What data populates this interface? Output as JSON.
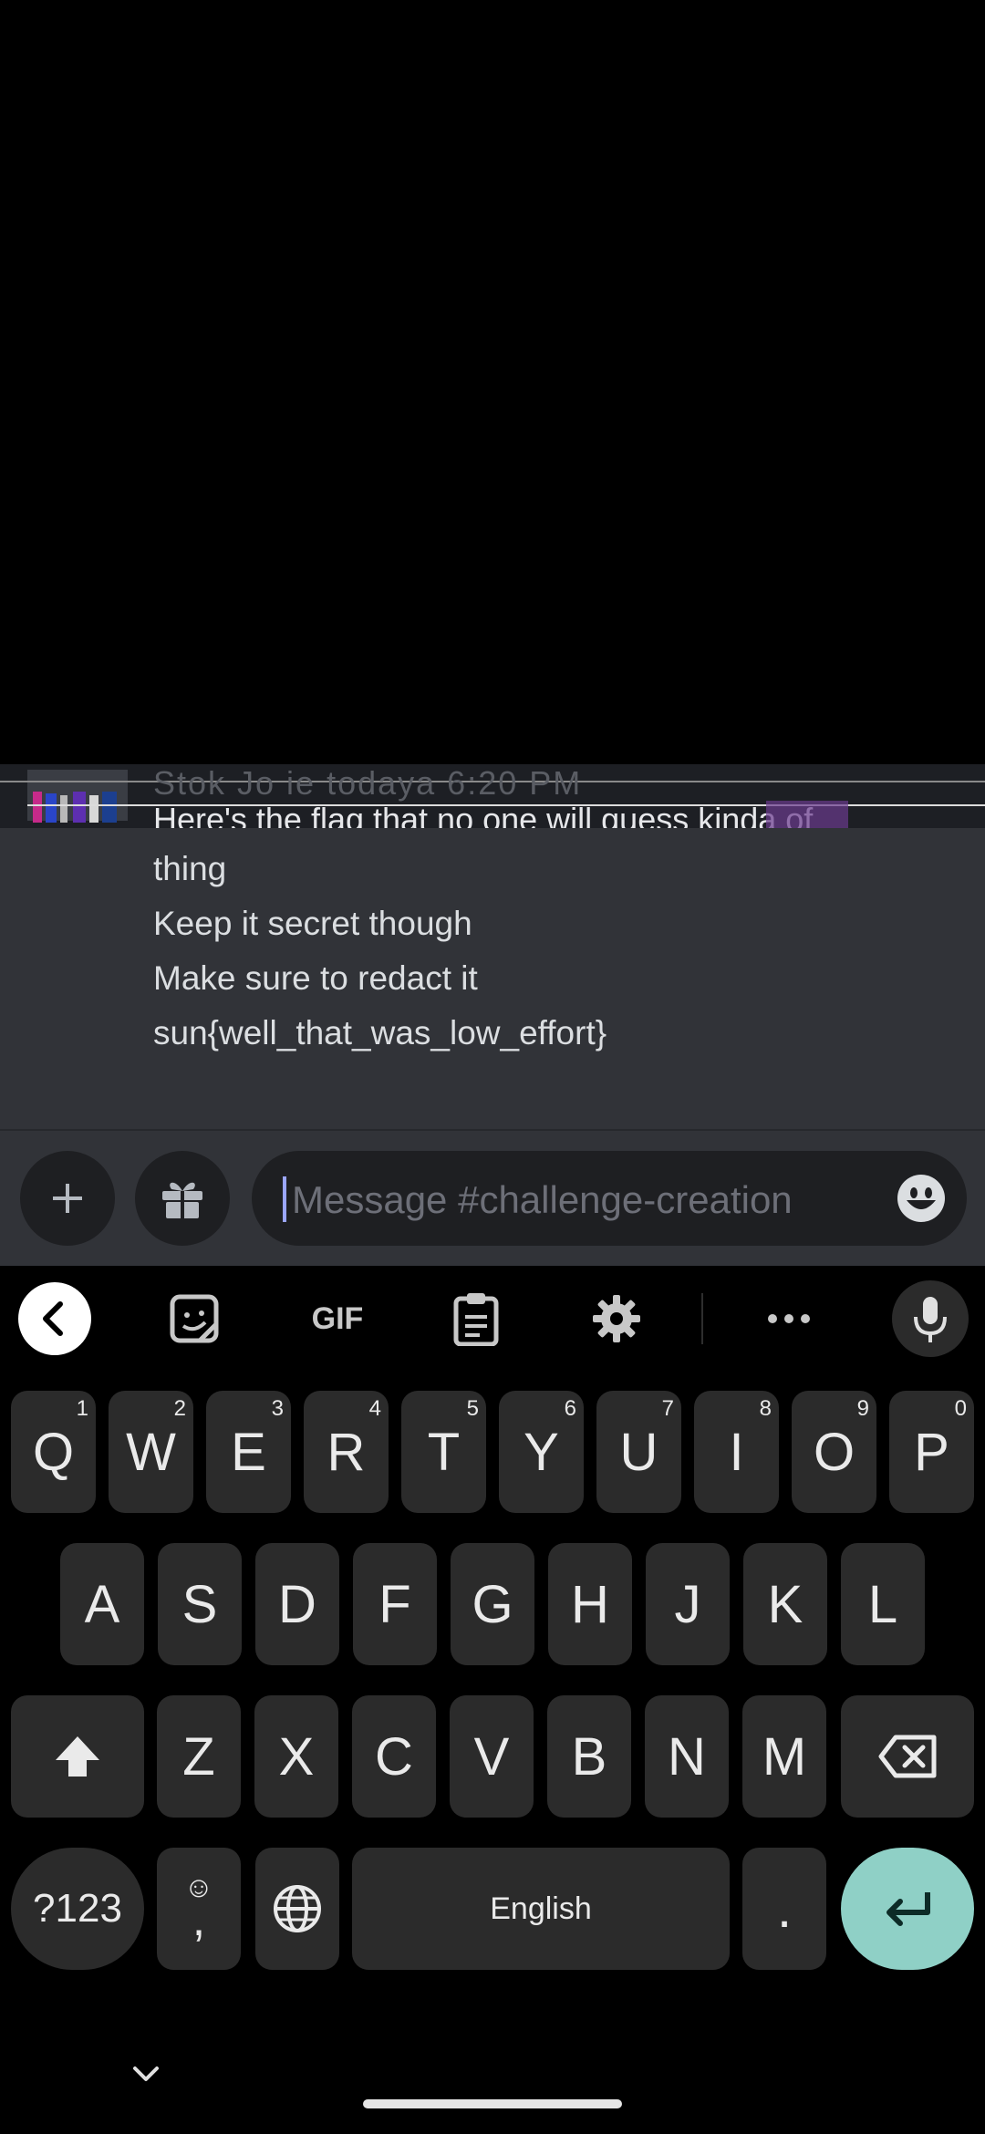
{
  "chat": {
    "faded_header": "Stok  Jo  ie  todaya  6:20 PM",
    "messages": [
      "Here's the flag that no one will guess  kinda of",
      "thing",
      "Keep it secret though",
      "Make sure to redact it",
      "sun{well_that_was_low_effort}"
    ]
  },
  "composer": {
    "placeholder": "Message #challenge-creation",
    "add_icon": "plus-icon",
    "gift_icon": "gift-icon",
    "emoji_icon": "emoji-icon"
  },
  "keyboard": {
    "toolbar": {
      "back_icon": "chevron-left-icon",
      "sticker_icon": "sticker-icon",
      "gif_label": "GIF",
      "clipboard_icon": "clipboard-icon",
      "settings_icon": "gear-icon",
      "more_icon": "more-icon",
      "mic_icon": "microphone-icon"
    },
    "row1": [
      {
        "k": "Q",
        "s": "1"
      },
      {
        "k": "W",
        "s": "2"
      },
      {
        "k": "E",
        "s": "3"
      },
      {
        "k": "R",
        "s": "4"
      },
      {
        "k": "T",
        "s": "5"
      },
      {
        "k": "Y",
        "s": "6"
      },
      {
        "k": "U",
        "s": "7"
      },
      {
        "k": "I",
        "s": "8"
      },
      {
        "k": "O",
        "s": "9"
      },
      {
        "k": "P",
        "s": "0"
      }
    ],
    "row2": [
      "A",
      "S",
      "D",
      "F",
      "G",
      "H",
      "J",
      "K",
      "L"
    ],
    "row3": [
      "Z",
      "X",
      "C",
      "V",
      "B",
      "N",
      "M"
    ],
    "symbols_label": "?123",
    "comma_label": ",",
    "space_label": "English",
    "period_label": ".",
    "accent_color": "#8fd0c6"
  }
}
